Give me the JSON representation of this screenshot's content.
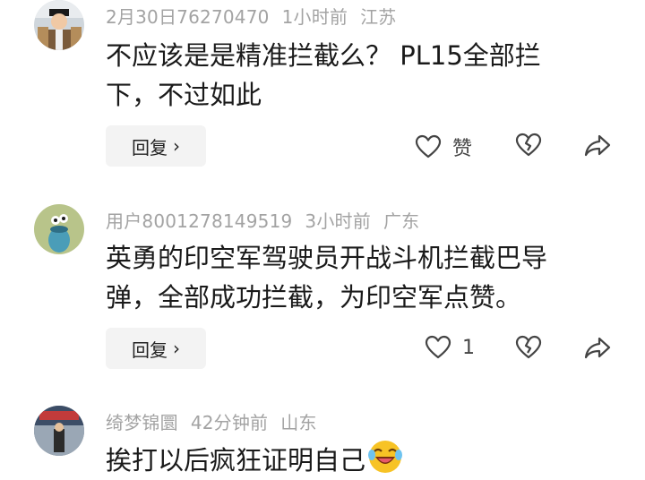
{
  "comments": [
    {
      "username": "2月30日76270470",
      "time": "1小时前",
      "location": "江苏",
      "text_lines": [
        "不应该是是精准拦截么？ PL15全部拦",
        "下，不过如此"
      ],
      "reply_label": "回复",
      "like_label": "赞",
      "like_count": ""
    },
    {
      "username": "用户8001278149519",
      "time": "3小时前",
      "location": "广东",
      "text_lines": [
        "英勇的印空军驾驶员开战斗机拦截巴导",
        "弹，全部成功拦截，为印空军点赞。"
      ],
      "reply_label": "回复",
      "like_label": "",
      "like_count": "1"
    },
    {
      "username": "绮梦锦圜",
      "time": "42分钟前",
      "location": "山东",
      "text_lines": [
        "挨打以后疯狂证明自己"
      ],
      "reply_label": "",
      "like_label": "",
      "like_count": ""
    }
  ],
  "colors": {
    "meta": "#a3a3a3",
    "text": "#1a1a1a",
    "reply_bg": "#f3f3f3",
    "icon": "#444444"
  },
  "icons": [
    "heart-icon",
    "broken-heart-icon",
    "share-icon",
    "chevron-right-icon",
    "laughing-emoji-icon"
  ]
}
